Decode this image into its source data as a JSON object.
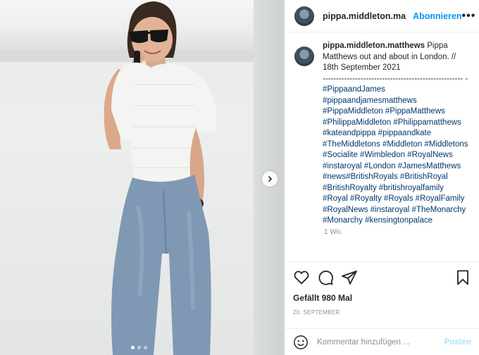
{
  "post": {
    "username": "pippa.middleton.matthews",
    "header_username": "pippa.middleton.ma",
    "follow_label": "Abonnieren",
    "more_label": "•••",
    "caption": {
      "lead": " Pippa Matthews out and about in London. // 18th September 2021",
      "divider": "---------------------------------------------------- -",
      "hashtags": "#PippaandJames #pippaandjamesmatthews #PippaMiddleton #PippaMatthews #PhilippaMiddleton #Philippamatthews #kateandpippa #pippaandkate #TheMiddletons #Middleton #Middletons #Socialite #Wimbledon #RoyalNews #instaroyal #London #JamesMatthews #news#BritishRoyals #BritishRoyal #BritishRoyalty #britishroyalfamily #Royal #Royalty #Royals #RoyalFamily #RoyalNews #instaroyal #TheMonarchy #Monarchy #kensingtonpalace",
      "time": "1 Wo."
    },
    "likes": "Gefällt 980 Mal",
    "date": "20. SEPTEMBER",
    "comment_placeholder": "Kommentar hinzufügen ...",
    "post_label": "Posten"
  },
  "icons": {
    "more": "more-icon",
    "like": "heart-icon",
    "comment": "comment-icon",
    "share": "share-icon",
    "save": "bookmark-icon",
    "emoji": "emoji-icon",
    "next": "chevron-right-icon"
  },
  "carousel": {
    "slides": 3,
    "active": 1
  },
  "colors": {
    "accent": "#0095f6",
    "hashtag": "#00376b",
    "muted": "#8e8e8e",
    "post_disabled": "#b2dffc"
  }
}
